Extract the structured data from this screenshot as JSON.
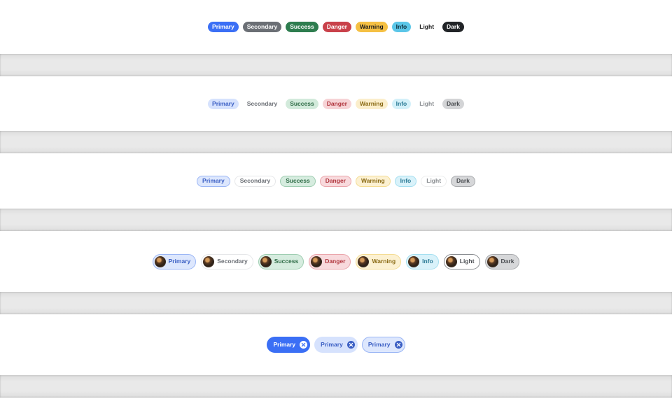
{
  "solid_badges": [
    {
      "label": "Primary",
      "bg": "#3b6ff5",
      "fg": "#ffffff"
    },
    {
      "label": "Secondary",
      "bg": "#6b6f75",
      "fg": "#ffffff"
    },
    {
      "label": "Success",
      "bg": "#2e7d4f",
      "fg": "#ffffff"
    },
    {
      "label": "Danger",
      "bg": "#c9414a",
      "fg": "#ffffff"
    },
    {
      "label": "Warning",
      "bg": "#f5c043",
      "fg": "#1a1a1a"
    },
    {
      "label": "Info",
      "bg": "#5bc6e8",
      "fg": "#0b2a36"
    },
    {
      "label": "Light",
      "bg": "transparent",
      "fg": "#1a1a1a"
    },
    {
      "label": "Dark",
      "bg": "#212427",
      "fg": "#ffffff"
    }
  ],
  "soft_badges": [
    {
      "label": "Primary",
      "bg": "#d6e2fd",
      "fg": "#3b5fc4"
    },
    {
      "label": "Secondary",
      "bg": "transparent",
      "fg": "#6b6f75"
    },
    {
      "label": "Success",
      "bg": "#d2eadb",
      "fg": "#2e6b46"
    },
    {
      "label": "Danger",
      "bg": "#f6d3d6",
      "fg": "#b0353d"
    },
    {
      "label": "Warning",
      "bg": "#fbeecb",
      "fg": "#8a6a14"
    },
    {
      "label": "Info",
      "bg": "#d3f0f9",
      "fg": "#2a7a95"
    },
    {
      "label": "Light",
      "bg": "transparent",
      "fg": "#8a8d91"
    },
    {
      "label": "Dark",
      "bg": "#d3d4d6",
      "fg": "#4a4d51"
    }
  ],
  "bordered_badges": [
    {
      "label": "Primary",
      "bg": "#dde7fd",
      "fg": "#3b5fc4",
      "border": "#9bb6f5"
    },
    {
      "label": "Secondary",
      "bg": "#ffffff",
      "fg": "#6b6f75",
      "border": "#e6e7e9"
    },
    {
      "label": "Success",
      "bg": "#d6ecdf",
      "fg": "#2e6b46",
      "border": "#9fcdb1"
    },
    {
      "label": "Danger",
      "bg": "#f8dadd",
      "fg": "#b0353d",
      "border": "#eaa5ab"
    },
    {
      "label": "Warning",
      "bg": "#fcf1d2",
      "fg": "#8a6a14",
      "border": "#f4dc94"
    },
    {
      "label": "Info",
      "bg": "#d9f2fa",
      "fg": "#2a7a95",
      "border": "#a5dff0"
    },
    {
      "label": "Light",
      "bg": "#ffffff",
      "fg": "#8a8d91",
      "border": "#eceded"
    },
    {
      "label": "Dark",
      "bg": "#d6d7d9",
      "fg": "#4a4d51",
      "border": "#a9abae"
    }
  ],
  "avatar_badges": [
    {
      "label": "Primary",
      "bg": "#dde7fd",
      "fg": "#3b5fc4",
      "border": "#9bb6f5"
    },
    {
      "label": "Secondary",
      "bg": "#ffffff",
      "fg": "#6b6f75",
      "border": "#e6e7e9"
    },
    {
      "label": "Success",
      "bg": "#d6ecdf",
      "fg": "#2e6b46",
      "border": "#9fcdb1"
    },
    {
      "label": "Danger",
      "bg": "#f8dadd",
      "fg": "#b0353d",
      "border": "#eaa5ab"
    },
    {
      "label": "Warning",
      "bg": "#fcf1d2",
      "fg": "#8a6a14",
      "border": "#f4dc94"
    },
    {
      "label": "Info",
      "bg": "#d9f2fa",
      "fg": "#2a7a95",
      "border": "#a5dff0"
    },
    {
      "label": "Light",
      "bg": "#ffffff",
      "fg": "#4a4d51",
      "border": "#8a8d91"
    },
    {
      "label": "Dark",
      "bg": "#d6d7d9",
      "fg": "#4a4d51",
      "border": "#a9abae"
    }
  ],
  "closable_badges": [
    {
      "label": "Primary",
      "bg": "#3b6ff5",
      "fg": "#ffffff",
      "border": "#3b6ff5",
      "close_bg": "#ffffff",
      "close_fg": "#3b6ff5",
      "icon": "close-icon"
    },
    {
      "label": "Primary",
      "bg": "#d6e2fd",
      "fg": "#3b5fc4",
      "border": "#d6e2fd",
      "close_bg": "#3b5fc4",
      "close_fg": "#ffffff",
      "icon": "close-icon"
    },
    {
      "label": "Primary",
      "bg": "#dde7fd",
      "fg": "#3b5fc4",
      "border": "#9bb6f5",
      "close_bg": "#3b5fc4",
      "close_fg": "#ffffff",
      "icon": "close-icon"
    }
  ]
}
